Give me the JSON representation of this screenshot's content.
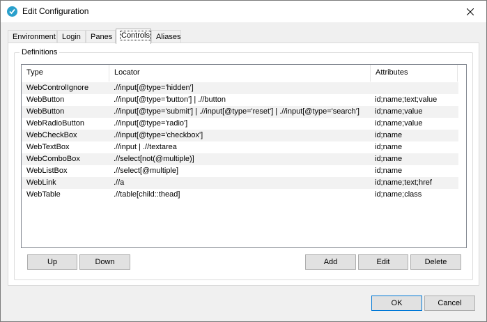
{
  "window": {
    "title": "Edit Configuration"
  },
  "tabs": [
    {
      "label": "Environment"
    },
    {
      "label": "Login"
    },
    {
      "label": "Panes"
    },
    {
      "label": "Controls",
      "active": true
    },
    {
      "label": "Aliases"
    }
  ],
  "definitions": {
    "group_label": "Definitions",
    "columns": {
      "type": "Type",
      "locator": "Locator",
      "attributes": "Attributes"
    },
    "rows": [
      {
        "type": "WebControlIgnore",
        "locator": ".//input[@type='hidden']",
        "attributes": ""
      },
      {
        "type": "WebButton",
        "locator": ".//input[@type='button'] | .//button",
        "attributes": "id;name;text;value"
      },
      {
        "type": "WebButton",
        "locator": ".//input[@type='submit'] | .//input[@type='reset'] | .//input[@type='search']",
        "attributes": "id;name;value"
      },
      {
        "type": "WebRadioButton",
        "locator": ".//input[@type='radio']",
        "attributes": "id;name;value"
      },
      {
        "type": "WebCheckBox",
        "locator": ".//input[@type='checkbox']",
        "attributes": "id;name"
      },
      {
        "type": "WebTextBox",
        "locator": ".//input | .//textarea",
        "attributes": "id;name"
      },
      {
        "type": "WebComboBox",
        "locator": ".//select[not(@multiple)]",
        "attributes": "id;name"
      },
      {
        "type": "WebListBox",
        "locator": ".//select[@multiple]",
        "attributes": "id;name"
      },
      {
        "type": "WebLink",
        "locator": ".//a",
        "attributes": "id;name;text;href"
      },
      {
        "type": "WebTable",
        "locator": ".//table[child::thead]",
        "attributes": "id;name;class"
      }
    ]
  },
  "buttons": {
    "up": "Up",
    "down": "Down",
    "add": "Add",
    "edit": "Edit",
    "delete": "Delete",
    "ok": "OK",
    "cancel": "Cancel"
  },
  "icons": {
    "app": "app-check-icon",
    "close": "close-icon"
  },
  "colors": {
    "app_icon": "#2aa0cc",
    "row_stripe": "#f2f2f2",
    "dialog_bg": "#f0f0f0"
  }
}
